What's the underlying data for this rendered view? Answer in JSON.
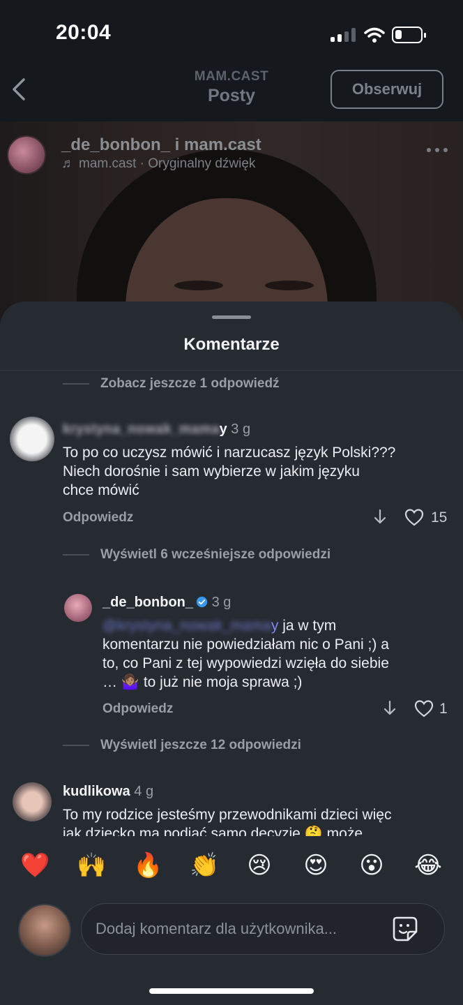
{
  "status_bar": {
    "time": "20:04"
  },
  "header": {
    "subtitle": "MAM.CAST",
    "title": "Posty",
    "follow_label": "Obserwuj"
  },
  "post": {
    "authors": "_de_bonbon_ i mam.cast",
    "audio": "mam.cast · Oryginalny dźwięk"
  },
  "sheet": {
    "title": "Komentarze",
    "comments": [
      {
        "toggle_above": "Zobacz jeszcze 1 odpowiedź",
        "username_visible_suffix": "y",
        "time": "3 g",
        "text_lines": [
          "To po co uczysz mówić i narzucasz język Polski???",
          "Niech dorośnie i sam wybierze w jakim języku",
          "chce mówić"
        ],
        "reply_label": "Odpowiedz",
        "likes": "15"
      },
      {
        "toggle_above": "Wyświetl 6 wcześniejsze odpowiedzi",
        "username": "_de_bonbon_",
        "time": "3 g",
        "mention_suffix": "y",
        "text_lines": [
          " ja w tym",
          "komentarzu nie powiedziałam nic o Pani ;) a",
          "to, co Pani z tej wypowiedzi wzięła do siebie",
          "… 🤷🏽‍♀️ to już nie moja sprawa ;)"
        ],
        "reply_label": "Odpowiedz",
        "likes": "1"
      },
      {
        "toggle_above": "Wyświetl jeszcze 12 odpowiedzi",
        "username": "kudlikowa",
        "time": "4 g",
        "text_lines": [
          "To my rodzice jesteśmy przewodnikami dzieci więc",
          "jak dziecko ma podjąć samo decyzję 🤔 może"
        ]
      }
    ]
  },
  "emoji_bar": [
    "❤️",
    "🙌",
    "🔥",
    "👏",
    "😢",
    "😍",
    "😮",
    "😂"
  ],
  "input": {
    "placeholder": "Dodaj komentarz dla użytkownika..."
  }
}
